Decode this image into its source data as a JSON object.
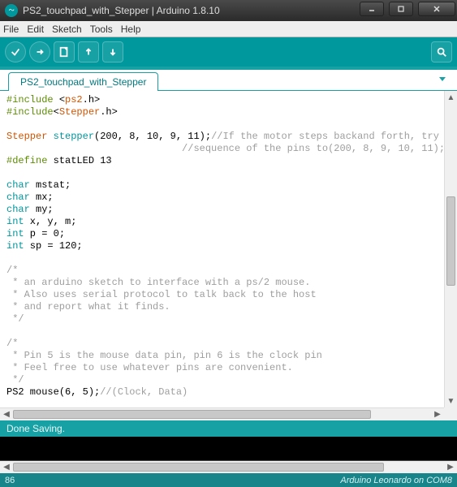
{
  "window": {
    "title": "PS2_touchpad_with_Stepper | Arduino 1.8.10"
  },
  "menu": {
    "file": "File",
    "edit": "Edit",
    "sketch": "Sketch",
    "tools": "Tools",
    "help": "Help"
  },
  "tabs": {
    "active": "PS2_touchpad_with_Stepper"
  },
  "code": {
    "l01a": "#include ",
    "l01b": "<",
    "l01c": "ps2",
    "l01d": ".h>",
    "l02a": "#include",
    "l02b": "<",
    "l02c": "Stepper",
    "l02d": ".h>",
    "l03": "",
    "l04a": "Stepper",
    "l04b": " stepper",
    "l04c": "(200, 8, 10, 9, 11);",
    "l04d": "//If the motor steps backand forth, try replacing the",
    "l05": "                              //sequence of the pins to(200, 8, 9, 10, 11);",
    "l06a": "#define ",
    "l06b": "statLED 13",
    "l07": "",
    "l08a": "char",
    "l08b": " mstat;",
    "l09a": "char",
    "l09b": " mx;",
    "l10a": "char",
    "l10b": " my;",
    "l11a": "int",
    "l11b": " x, y, m;",
    "l12a": "int",
    "l12b": " p = 0;",
    "l13a": "int",
    "l13b": " sp = 120;",
    "l14": "",
    "l15": "/*",
    "l16": " * an arduino sketch to interface with a ps/2 mouse.",
    "l17": " * Also uses serial protocol to talk back to the host",
    "l18": " * and report what it finds.",
    "l19": " */",
    "l20": "",
    "l21": "/*",
    "l22": " * Pin 5 is the mouse data pin, pin 6 is the clock pin",
    "l23": " * Feel free to use whatever pins are convenient.",
    "l24": " */",
    "l25a": "PS2 mouse",
    "l25b": "(6, 5);",
    "l25c": "//(Clock, Data)",
    "l26": "",
    "l27": "/*"
  },
  "status": {
    "message": "Done Saving."
  },
  "footer": {
    "line": "86",
    "board": "Arduino Leonardo on COM8"
  }
}
